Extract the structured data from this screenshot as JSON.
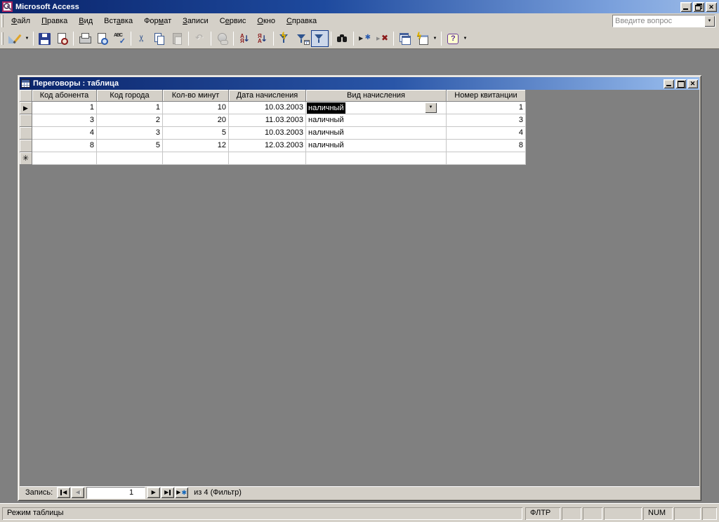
{
  "window": {
    "title": "Microsoft Access"
  },
  "menu": {
    "items": [
      {
        "pre": "",
        "key": "Ф",
        "post": "айл"
      },
      {
        "pre": "",
        "key": "П",
        "post": "равка"
      },
      {
        "pre": "",
        "key": "В",
        "post": "ид"
      },
      {
        "pre": "Вст",
        "key": "а",
        "post": "вка"
      },
      {
        "pre": "Фор",
        "key": "м",
        "post": "ат"
      },
      {
        "pre": "",
        "key": "З",
        "post": "аписи"
      },
      {
        "pre": "С",
        "key": "е",
        "post": "рвис"
      },
      {
        "pre": "",
        "key": "О",
        "post": "кно"
      },
      {
        "pre": "",
        "key": "С",
        "post": "правка"
      }
    ],
    "ask_placeholder": "Введите вопрос"
  },
  "toolbar": {
    "buttons": [
      "view",
      "save",
      "file-search",
      "print",
      "print-preview",
      "spelling",
      "cut",
      "copy",
      "paste",
      "undo",
      "hyperlink",
      "sort-ascending",
      "sort-descending",
      "filter-by-selection",
      "filter-by-form",
      "apply-filter",
      "find",
      "new-record",
      "delete-record",
      "database-window",
      "new-object",
      "help"
    ],
    "pressed": "apply-filter"
  },
  "doc": {
    "title": "Переговоры : таблица"
  },
  "table": {
    "columns": [
      "Код абонента",
      "Код города",
      "Кол-во минут",
      "Дата начисления",
      "Вид начисления",
      "Номер квитанции"
    ],
    "rows": [
      {
        "cells": [
          "1",
          "1",
          "10",
          "10.03.2003",
          "наличный",
          "1"
        ],
        "current": true,
        "selected_cell": "Вид начисления"
      },
      {
        "cells": [
          "3",
          "2",
          "20",
          "11.03.2003",
          "наличный",
          "3"
        ]
      },
      {
        "cells": [
          "4",
          "3",
          "5",
          "10.03.2003",
          "наличный",
          "4"
        ]
      },
      {
        "cells": [
          "8",
          "5",
          "12",
          "12.03.2003",
          "наличный",
          "8"
        ]
      }
    ],
    "has_new_row": true
  },
  "nav": {
    "label": "Запись:",
    "value": "1",
    "suffix": "из 4 (Фильтр)"
  },
  "status": {
    "mode": "Режим таблицы",
    "filter": "ФЛТР",
    "num": "NUM"
  },
  "colors": {
    "titlebar_left": "#0a246a",
    "titlebar_right": "#9dbce8",
    "chrome": "#d4d0c8",
    "workspace": "#808080",
    "selection_bg": "#000000",
    "selection_fg": "#ffffff"
  }
}
